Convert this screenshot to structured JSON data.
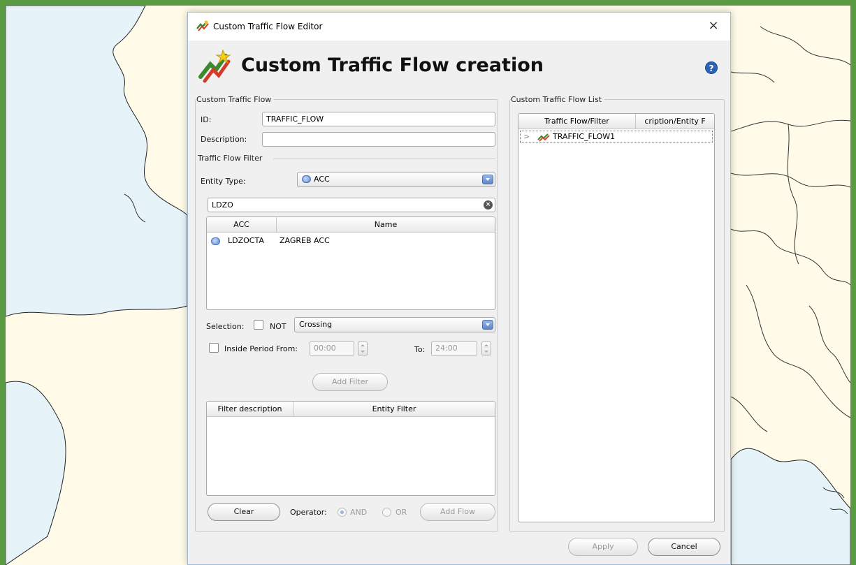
{
  "window": {
    "title": "Custom Traffic Flow Editor",
    "close_glyph": "×"
  },
  "header": {
    "title": "Custom Traffic Flow creation",
    "help_glyph": "?"
  },
  "custom_flow": {
    "group_title": "Custom Traffic Flow",
    "id_label": "ID:",
    "id_value": "TRAFFIC_FLOW",
    "description_label": "Description:",
    "description_value": ""
  },
  "filter": {
    "group_title": "Traffic Flow Filter",
    "entity_type_label": "Entity Type:",
    "entity_type_value": "ACC",
    "search_value": "LDZO",
    "table": {
      "columns": [
        "ACC",
        "Name"
      ],
      "rows": [
        {
          "acc": "LDZOCTA",
          "name": "ZAGREB ACC"
        }
      ]
    },
    "selection_label": "Selection:",
    "not_label": "NOT",
    "not_checked": false,
    "selection_value": "Crossing",
    "inside_period_label": "Inside Period From:",
    "inside_period_checked": false,
    "from_value": "00:00",
    "to_label": "To:",
    "to_value": "24:00",
    "add_filter_label": "Add Filter"
  },
  "filter_list": {
    "columns": [
      "Filter description",
      "Entity Filter"
    ],
    "clear_label": "Clear",
    "operator_label": "Operator:",
    "and_label": "AND",
    "or_label": "OR",
    "operator_selected": "AND",
    "add_flow_label": "Add Flow"
  },
  "flow_list": {
    "group_title": "Custom Traffic Flow List",
    "columns": [
      "Traffic Flow/Filter",
      "cription/Entity F"
    ],
    "items": [
      {
        "expander": ">",
        "name": "TRAFFIC_FLOW1"
      }
    ]
  },
  "footer": {
    "apply_label": "Apply",
    "cancel_label": "Cancel"
  },
  "colors": {
    "frame_border": "#5a9a43",
    "map_land": "#fffbe8",
    "map_sea": "#e6f4fa",
    "accent_blue": "#5f85c7"
  },
  "icons": [
    "traffic-flow-icon",
    "close-icon",
    "help-icon",
    "acc-icon",
    "clear-search-icon",
    "dropdown-arrow-icon",
    "expand-chevron-icon"
  ]
}
